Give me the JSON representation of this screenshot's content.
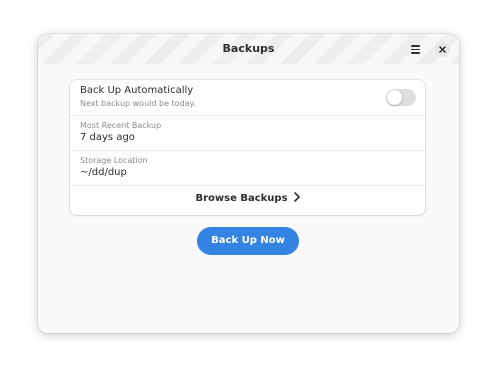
{
  "window": {
    "title": "Backups"
  },
  "header": {
    "menu_icon": "hamburger-menu-icon",
    "close_icon": "close-icon"
  },
  "settings": {
    "auto_backup": {
      "title": "Back Up Automatically",
      "subtitle": "Next backup would be today.",
      "enabled": false
    },
    "recent": {
      "label": "Most Recent Backup",
      "value": "7 days ago"
    },
    "location": {
      "label": "Storage Location",
      "value": "~/dd/dup"
    },
    "browse": {
      "label": "Browse Backups",
      "icon": "chevron-right-icon"
    }
  },
  "actions": {
    "backup_now": "Back Up Now"
  },
  "colors": {
    "accent": "#3584e4",
    "switch_off": "#dedede",
    "window_bg": "#fafafa",
    "card_bg": "#ffffff"
  }
}
